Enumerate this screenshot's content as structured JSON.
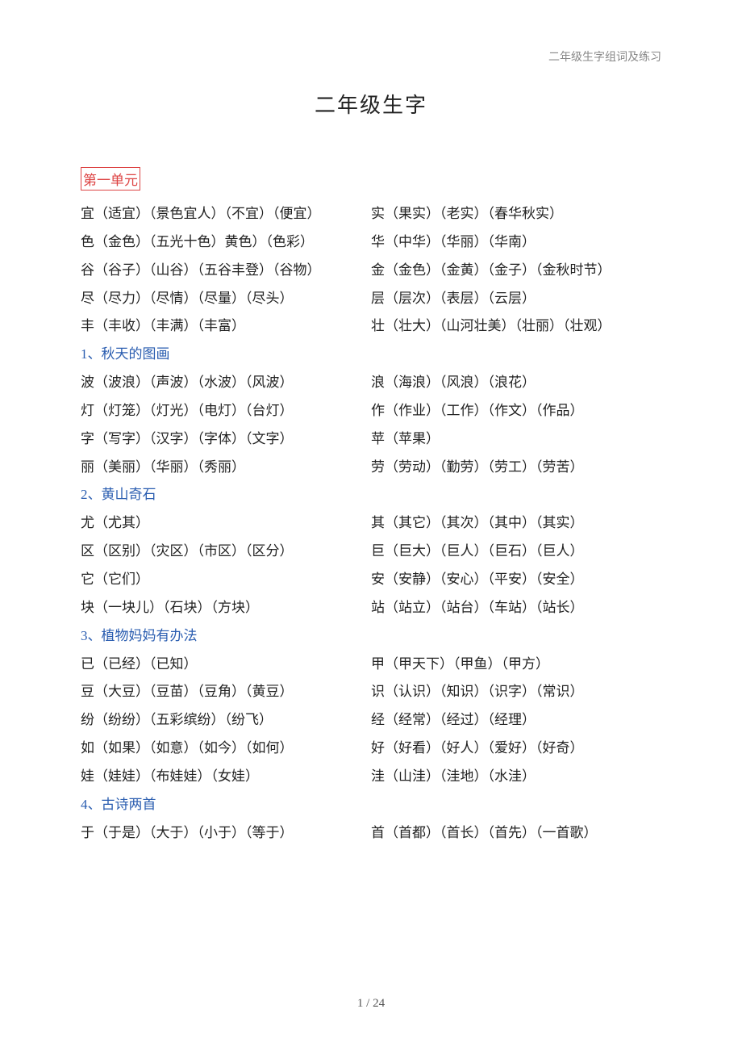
{
  "header": "二年级生字组词及练习",
  "title": "二年级生字",
  "unit_label": "第一单元",
  "footer": "1 / 24",
  "sections": [
    {
      "heading": null,
      "rows": [
        {
          "l": "宜（适宜）（景色宜人）（不宜）（便宜）",
          "r": "实（果实）（老实）（春华秋实）"
        },
        {
          "l": "色（金色）（五光十色）黄色）（色彩）",
          "r": "华（中华）（华丽）（华南）"
        },
        {
          "l": "谷（谷子）（山谷）（五谷丰登）（谷物）",
          "r": "金（金色）（金黄）（金子）（金秋时节）"
        },
        {
          "l": "尽（尽力）（尽情）（尽量）（尽头）",
          "r": "层（层次）（表层）（云层）"
        },
        {
          "l": "丰（丰收）（丰满）（丰富）",
          "r": "壮（壮大）（山河壮美）（壮丽）（壮观）"
        }
      ]
    },
    {
      "heading": "1、秋天的图画",
      "rows": [
        {
          "l": "波（波浪）（声波）（水波）（风波）",
          "r": "浪（海浪）（风浪）（浪花）"
        },
        {
          "l": "灯（灯笼）（灯光）（电灯）（台灯）",
          "r": "作（作业）（工作）（作文）（作品）"
        },
        {
          "l": "字（写字）（汉字）（字体）（文字）",
          "r": "苹（苹果）"
        },
        {
          "l": "丽（美丽）（华丽）（秀丽）",
          "r": "劳（劳动）（勤劳）（劳工）（劳苦）"
        }
      ]
    },
    {
      "heading": "2、黄山奇石",
      "rows": [
        {
          "l": "尤（尤其）",
          "r": "其（其它）（其次）（其中）（其实）"
        },
        {
          "l": "区（区别）（灾区）（市区）（区分）",
          "r": "巨（巨大）（巨人）（巨石）（巨人）"
        },
        {
          "l": "它（它们）",
          "r": "安（安静）（安心）（平安）（安全）"
        },
        {
          "l": "块（一块儿）（石块）（方块）",
          "r": "站（站立）（站台）（车站）（站长）"
        }
      ]
    },
    {
      "heading": "3、植物妈妈有办法",
      "rows": [
        {
          "l": "已（已经）（已知）",
          "r": "甲（甲天下）（甲鱼）（甲方）"
        },
        {
          "l": "豆（大豆）（豆苗）（豆角）（黄豆）",
          "r": "识（认识）（知识）（识字）（常识）"
        },
        {
          "l": "纷（纷纷）（五彩缤纷）（纷飞）",
          "r": "经（经常）（经过）（经理）"
        },
        {
          "l": "如（如果）（如意）（如今）（如何）",
          "r": "好（好看）（好人）（爱好）（好奇）"
        },
        {
          "l": "娃（娃娃）（布娃娃）（女娃）",
          "r": "洼（山洼）（洼地）（水洼）"
        }
      ]
    },
    {
      "heading": "4、古诗两首",
      "rows": [
        {
          "l": "于（于是）（大于）（小于）（等于）",
          "r": "首（首都）（首长）（首先）（一首歌）"
        }
      ]
    }
  ]
}
